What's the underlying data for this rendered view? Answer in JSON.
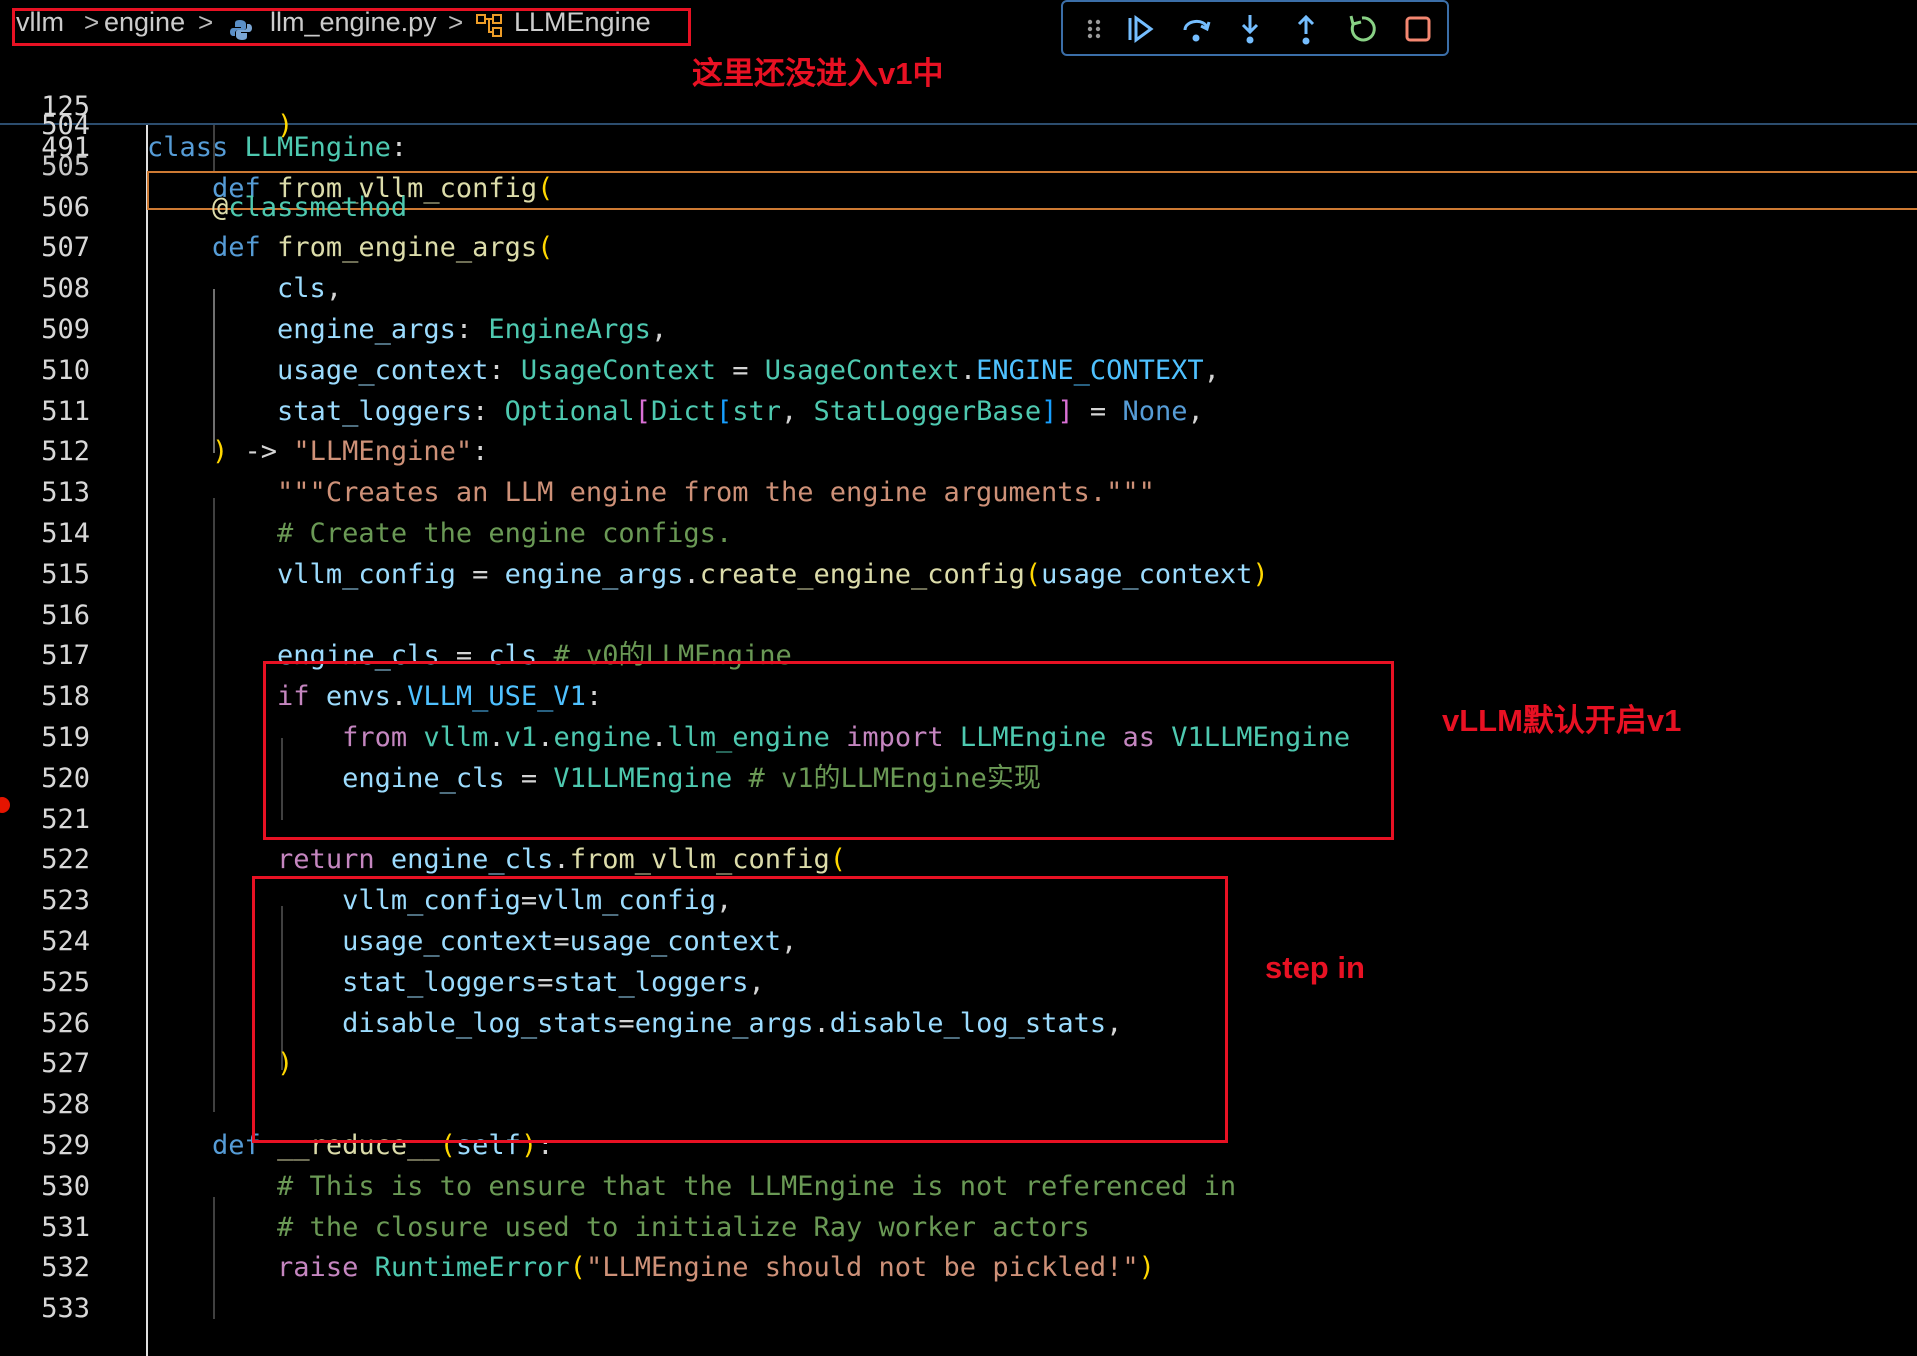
{
  "breadcrumb": {
    "items": [
      "vllm",
      "engine",
      "llm_engine.py",
      "LLMEngine"
    ],
    "separator": ">"
  },
  "debug_toolbar": {
    "buttons": [
      "drag-handle",
      "continue",
      "step-over",
      "step-into",
      "step-out",
      "restart",
      "stop"
    ]
  },
  "annotations": {
    "top_note": "这里还没进入v1中",
    "v1_note": "vLLM默认开启v1",
    "step_note": "step in"
  },
  "sticky": [
    {
      "ln": "125",
      "tokens": [
        [
          "kw",
          "class"
        ],
        [
          "pl",
          " "
        ],
        [
          "cls",
          "LLMEngine"
        ],
        [
          "pl",
          ":"
        ]
      ]
    },
    {
      "ln": "491",
      "tokens": [
        [
          "pl",
          "    "
        ],
        [
          "kw",
          "def"
        ],
        [
          "pl",
          " "
        ],
        [
          "fn",
          "from_vllm_config"
        ],
        [
          "par",
          "("
        ]
      ]
    }
  ],
  "lines": [
    {
      "ln": "504",
      "tokens": [
        [
          "pl",
          "        "
        ],
        [
          "par",
          ")"
        ]
      ]
    },
    {
      "ln": "505",
      "tokens": []
    },
    {
      "ln": "506",
      "tokens": [
        [
          "pl",
          "    "
        ],
        [
          "dec",
          "@"
        ],
        [
          "cls",
          "classmethod"
        ]
      ]
    },
    {
      "ln": "507",
      "tokens": [
        [
          "pl",
          "    "
        ],
        [
          "kw",
          "def"
        ],
        [
          "pl",
          " "
        ],
        [
          "fn",
          "from_engine_args"
        ],
        [
          "par",
          "("
        ]
      ]
    },
    {
      "ln": "508",
      "tokens": [
        [
          "pl",
          "        "
        ],
        [
          "var",
          "cls"
        ],
        [
          "pl",
          ","
        ]
      ]
    },
    {
      "ln": "509",
      "tokens": [
        [
          "pl",
          "        "
        ],
        [
          "var",
          "engine_args"
        ],
        [
          "pl",
          ": "
        ],
        [
          "cls",
          "EngineArgs"
        ],
        [
          "pl",
          ","
        ]
      ]
    },
    {
      "ln": "510",
      "tokens": [
        [
          "pl",
          "        "
        ],
        [
          "var",
          "usage_context"
        ],
        [
          "pl",
          ": "
        ],
        [
          "cls",
          "UsageContext"
        ],
        [
          "pl",
          " = "
        ],
        [
          "cls",
          "UsageContext"
        ],
        [
          "pl",
          "."
        ],
        [
          "const",
          "ENGINE_CONTEXT"
        ],
        [
          "pl",
          ","
        ]
      ]
    },
    {
      "ln": "511",
      "tokens": [
        [
          "pl",
          "        "
        ],
        [
          "var",
          "stat_loggers"
        ],
        [
          "pl",
          ": "
        ],
        [
          "cls",
          "Optional"
        ],
        [
          "par2",
          "["
        ],
        [
          "cls",
          "Dict"
        ],
        [
          "par3",
          "["
        ],
        [
          "cls",
          "str"
        ],
        [
          "pl",
          ", "
        ],
        [
          "cls",
          "StatLoggerBase"
        ],
        [
          "par3",
          "]"
        ],
        [
          "par2",
          "]"
        ],
        [
          "pl",
          " = "
        ],
        [
          "kw",
          "None"
        ],
        [
          "pl",
          ","
        ]
      ]
    },
    {
      "ln": "512",
      "tokens": [
        [
          "pl",
          "    "
        ],
        [
          "par",
          ")"
        ],
        [
          "pl",
          " -> "
        ],
        [
          "str",
          "\"LLMEngine\""
        ],
        [
          "pl",
          ":"
        ]
      ]
    },
    {
      "ln": "513",
      "tokens": [
        [
          "pl",
          "        "
        ],
        [
          "str",
          "\"\"\"Creates an LLM engine from the engine arguments.\"\"\""
        ]
      ]
    },
    {
      "ln": "514",
      "tokens": [
        [
          "pl",
          "        "
        ],
        [
          "cmt",
          "# Create the engine configs."
        ]
      ]
    },
    {
      "ln": "515",
      "tokens": [
        [
          "pl",
          "        "
        ],
        [
          "var",
          "vllm_config"
        ],
        [
          "pl",
          " = "
        ],
        [
          "var",
          "engine_args"
        ],
        [
          "pl",
          "."
        ],
        [
          "fn",
          "create_engine_config"
        ],
        [
          "par",
          "("
        ],
        [
          "var",
          "usage_context"
        ],
        [
          "par",
          ")"
        ]
      ]
    },
    {
      "ln": "516",
      "tokens": []
    },
    {
      "ln": "517",
      "tokens": [
        [
          "pl",
          "        "
        ],
        [
          "var",
          "engine_cls"
        ],
        [
          "pl",
          " = "
        ],
        [
          "var",
          "cls"
        ],
        [
          "pl",
          " "
        ],
        [
          "cmt",
          "# v0的LLMEngine"
        ]
      ]
    },
    {
      "ln": "518",
      "tokens": [
        [
          "pl",
          "        "
        ],
        [
          "kw2",
          "if"
        ],
        [
          "pl",
          " "
        ],
        [
          "var",
          "envs"
        ],
        [
          "pl",
          "."
        ],
        [
          "const",
          "VLLM_USE_V1"
        ],
        [
          "pl",
          ":"
        ]
      ]
    },
    {
      "ln": "519",
      "tokens": [
        [
          "pl",
          "            "
        ],
        [
          "kw2",
          "from"
        ],
        [
          "pl",
          " "
        ],
        [
          "cls",
          "vllm"
        ],
        [
          "pl",
          "."
        ],
        [
          "cls",
          "v1"
        ],
        [
          "pl",
          "."
        ],
        [
          "cls",
          "engine"
        ],
        [
          "pl",
          "."
        ],
        [
          "cls",
          "llm_engine"
        ],
        [
          "pl",
          " "
        ],
        [
          "kw2",
          "import"
        ],
        [
          "pl",
          " "
        ],
        [
          "cls",
          "LLMEngine"
        ],
        [
          "pl",
          " "
        ],
        [
          "kw2",
          "as"
        ],
        [
          "pl",
          " "
        ],
        [
          "cls",
          "V1LLMEngine"
        ]
      ]
    },
    {
      "ln": "520",
      "tokens": [
        [
          "pl",
          "            "
        ],
        [
          "var",
          "engine_cls"
        ],
        [
          "pl",
          " = "
        ],
        [
          "cls",
          "V1LLMEngine"
        ],
        [
          "pl",
          " "
        ],
        [
          "cmt",
          "# v1的LLMEngine实现"
        ]
      ]
    },
    {
      "ln": "521",
      "tokens": []
    },
    {
      "ln": "522",
      "tokens": [
        [
          "pl",
          "        "
        ],
        [
          "kw2",
          "return"
        ],
        [
          "pl",
          " "
        ],
        [
          "var",
          "engine_cls"
        ],
        [
          "pl",
          "."
        ],
        [
          "fn",
          "from_vllm_config"
        ],
        [
          "par",
          "("
        ]
      ]
    },
    {
      "ln": "523",
      "tokens": [
        [
          "pl",
          "            "
        ],
        [
          "var",
          "vllm_config"
        ],
        [
          "pl",
          "="
        ],
        [
          "var",
          "vllm_config"
        ],
        [
          "pl",
          ","
        ]
      ]
    },
    {
      "ln": "524",
      "tokens": [
        [
          "pl",
          "            "
        ],
        [
          "var",
          "usage_context"
        ],
        [
          "pl",
          "="
        ],
        [
          "var",
          "usage_context"
        ],
        [
          "pl",
          ","
        ]
      ]
    },
    {
      "ln": "525",
      "tokens": [
        [
          "pl",
          "            "
        ],
        [
          "var",
          "stat_loggers"
        ],
        [
          "pl",
          "="
        ],
        [
          "var",
          "stat_loggers"
        ],
        [
          "pl",
          ","
        ]
      ]
    },
    {
      "ln": "526",
      "tokens": [
        [
          "pl",
          "            "
        ],
        [
          "var",
          "disable_log_stats"
        ],
        [
          "pl",
          "="
        ],
        [
          "var",
          "engine_args"
        ],
        [
          "pl",
          "."
        ],
        [
          "var",
          "disable_log_stats"
        ],
        [
          "pl",
          ","
        ]
      ]
    },
    {
      "ln": "527",
      "tokens": [
        [
          "pl",
          "        "
        ],
        [
          "par",
          ")"
        ]
      ]
    },
    {
      "ln": "528",
      "tokens": []
    },
    {
      "ln": "529",
      "tokens": [
        [
          "pl",
          "    "
        ],
        [
          "kw",
          "def"
        ],
        [
          "pl",
          " "
        ],
        [
          "fn",
          "__reduce__"
        ],
        [
          "par",
          "("
        ],
        [
          "var",
          "self"
        ],
        [
          "par",
          ")"
        ],
        [
          "pl",
          ":"
        ]
      ]
    },
    {
      "ln": "530",
      "tokens": [
        [
          "pl",
          "        "
        ],
        [
          "cmt",
          "# This is to ensure that the LLMEngine is not referenced in"
        ]
      ]
    },
    {
      "ln": "531",
      "tokens": [
        [
          "pl",
          "        "
        ],
        [
          "cmt",
          "# the closure used to initialize Ray worker actors"
        ]
      ]
    },
    {
      "ln": "532",
      "tokens": [
        [
          "pl",
          "        "
        ],
        [
          "kw2",
          "raise"
        ],
        [
          "pl",
          " "
        ],
        [
          "cls",
          "RuntimeError"
        ],
        [
          "par",
          "("
        ],
        [
          "str",
          "\"LLMEngine should not be pickled!\""
        ],
        [
          "par",
          ")"
        ]
      ]
    },
    {
      "ln": "533",
      "tokens": []
    }
  ],
  "colors": {
    "annotation": "#e81123",
    "current_line": "#ce7a33",
    "breakpoint": "#e51400",
    "toolbar_border": "#3b6ea8"
  }
}
